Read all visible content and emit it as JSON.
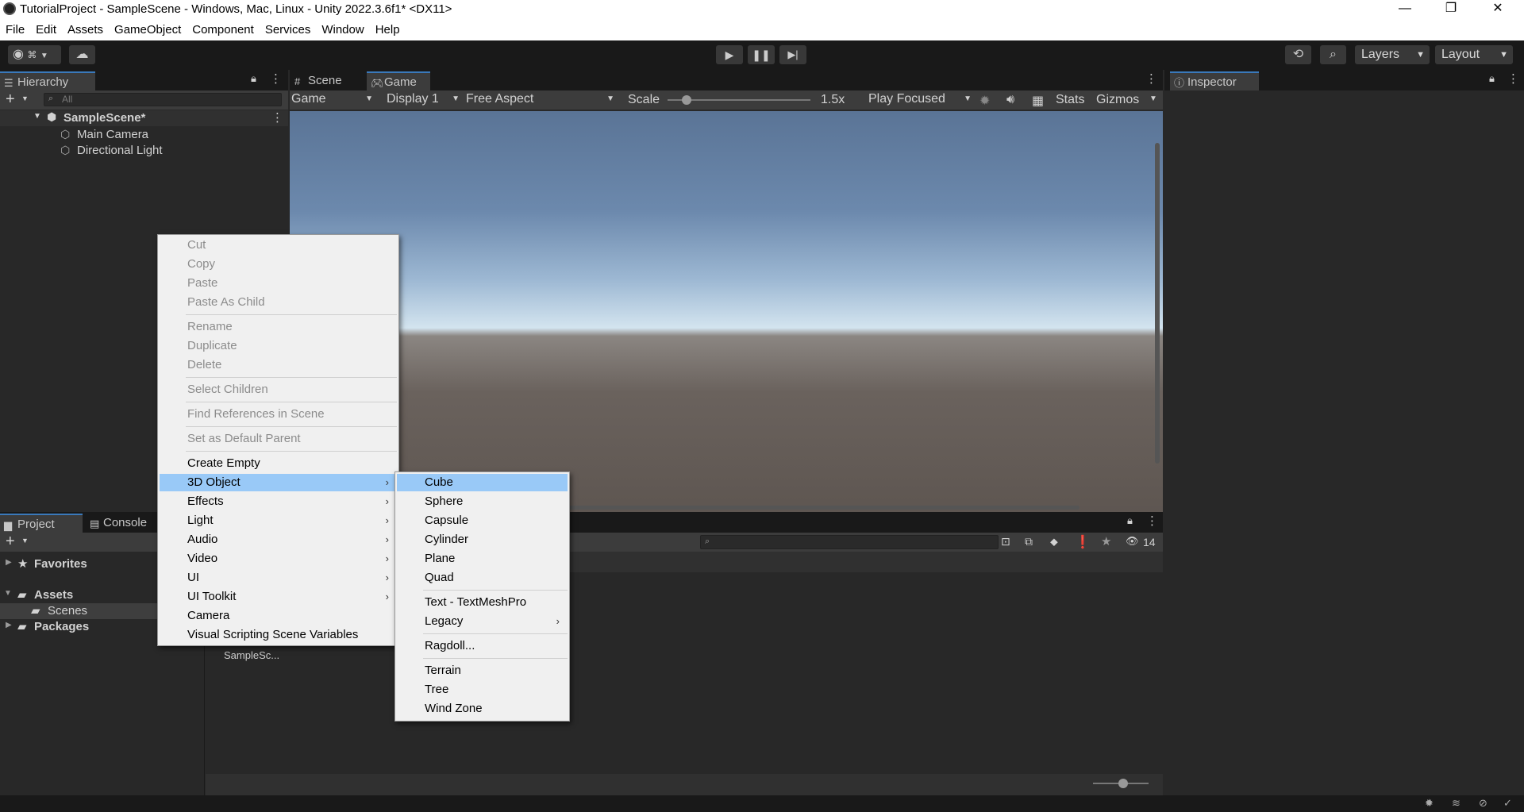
{
  "window": {
    "title": "TutorialProject - SampleScene - Windows, Mac, Linux - Unity 2022.3.6f1* <DX11>",
    "minimize": "—",
    "maximize": "❐",
    "close": "✕"
  },
  "menubar": [
    "File",
    "Edit",
    "Assets",
    "GameObject",
    "Component",
    "Services",
    "Window",
    "Help"
  ],
  "toolbar": {
    "layers": "Layers",
    "layout": "Layout"
  },
  "hierarchy": {
    "tab": "Hierarchy",
    "search_placeholder": "All",
    "scene": "SampleScene*",
    "items": [
      "Main Camera",
      "Directional Light"
    ]
  },
  "game_view": {
    "tab_scene": "Scene",
    "tab_game": "Game",
    "mode": "Game",
    "display": "Display 1",
    "aspect": "Free Aspect",
    "scale_label": "Scale",
    "scale_value": "1.5x",
    "play_focus": "Play Focused",
    "stats": "Stats",
    "gizmos": "Gizmos"
  },
  "inspector": {
    "tab": "Inspector"
  },
  "project": {
    "tab_project": "Project",
    "tab_console": "Console",
    "tree": [
      "Favorites",
      "Assets",
      "Scenes",
      "Packages"
    ],
    "asset": "SampleSc...",
    "hidden_count": "14"
  },
  "context_menu": {
    "items": [
      {
        "label": "Cut",
        "disabled": true
      },
      {
        "label": "Copy",
        "disabled": true
      },
      {
        "label": "Paste",
        "disabled": true
      },
      {
        "label": "Paste As Child",
        "disabled": true
      },
      {
        "label": "Rename",
        "disabled": true
      },
      {
        "label": "Duplicate",
        "disabled": true
      },
      {
        "label": "Delete",
        "disabled": true
      },
      {
        "label": "Select Children",
        "disabled": true
      },
      {
        "label": "Find References in Scene",
        "disabled": true
      },
      {
        "label": "Set as Default Parent",
        "disabled": true
      },
      {
        "label": "Create Empty",
        "disabled": false
      },
      {
        "label": "3D Object",
        "disabled": false,
        "submenu": true,
        "highlighted": true
      },
      {
        "label": "Effects",
        "disabled": false,
        "submenu": true
      },
      {
        "label": "Light",
        "disabled": false,
        "submenu": true
      },
      {
        "label": "Audio",
        "disabled": false,
        "submenu": true
      },
      {
        "label": "Video",
        "disabled": false,
        "submenu": true
      },
      {
        "label": "UI",
        "disabled": false,
        "submenu": true
      },
      {
        "label": "UI Toolkit",
        "disabled": false,
        "submenu": true
      },
      {
        "label": "Camera",
        "disabled": false
      },
      {
        "label": "Visual Scripting Scene Variables",
        "disabled": false
      }
    ]
  },
  "submenu_3d": {
    "items": [
      {
        "label": "Cube",
        "highlighted": true
      },
      {
        "label": "Sphere"
      },
      {
        "label": "Capsule"
      },
      {
        "label": "Cylinder"
      },
      {
        "label": "Plane"
      },
      {
        "label": "Quad"
      },
      {
        "label": "Text - TextMeshPro"
      },
      {
        "label": "Legacy",
        "submenu": true
      },
      {
        "label": "Ragdoll..."
      },
      {
        "label": "Terrain"
      },
      {
        "label": "Tree"
      },
      {
        "label": "Wind Zone"
      }
    ]
  },
  "colors": {
    "highlight": "#99c9f7",
    "tab_accent": "#3a79bb",
    "panel_bg": "#282828",
    "toolbar_bg": "#191919"
  }
}
